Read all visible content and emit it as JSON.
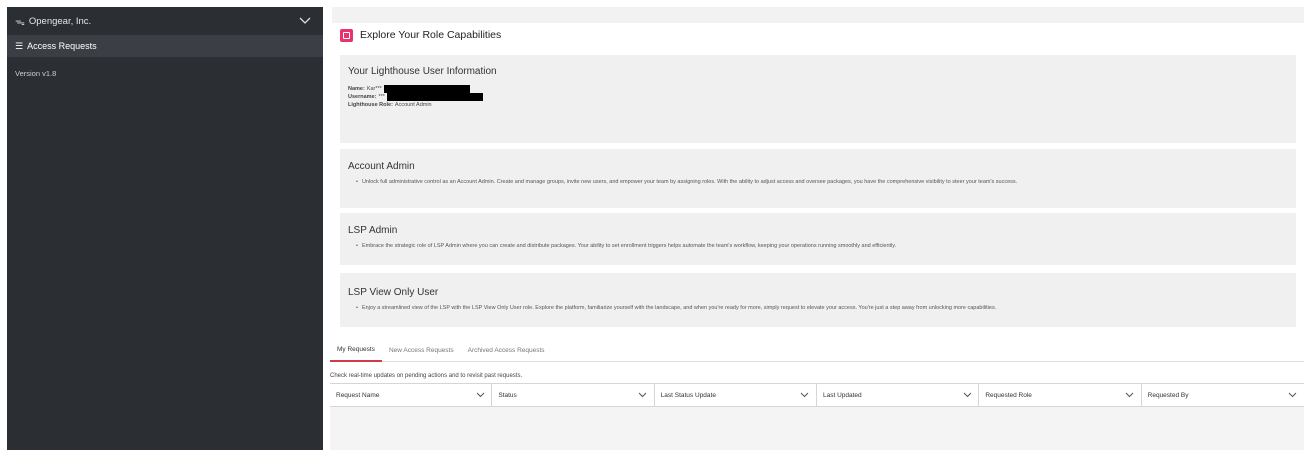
{
  "sidebar": {
    "org_name": "Opengear, Inc.",
    "nav_items": [
      {
        "label": "Access Requests",
        "icon": "list-icon"
      }
    ],
    "version": "Version v1.8"
  },
  "page": {
    "title": "Explore Your Role Capabilities",
    "accent_color": "#e8336d"
  },
  "user_info": {
    "title": "Your Lighthouse User Information",
    "name_label": "Name:",
    "name_value": "Kar***",
    "username_label": "Username:",
    "username_value": "***",
    "role_label": "Lighthouse Role:",
    "role_value": "Account Admin"
  },
  "roles": [
    {
      "title": "Account Admin",
      "description": "Unlock full administrative control as an Account Admin. Create and manage groups, invite new users, and empower your team by assigning roles. With the ability to adjust access and oversee packages, you have the comprehensive visibility to steer your team's success."
    },
    {
      "title": "LSP Admin",
      "description": "Embrace the strategic role of LSP Admin where you can create and distribute packages. Your ability to set enrollment triggers helps automate the team's workflow, keeping your operations running smoothly and efficiently."
    },
    {
      "title": "LSP View Only User",
      "description": "Enjoy a streamlined view of the LSP with the LSP View Only User role. Explore the platform, familiarize yourself with the landscape, and when you're ready for more, simply request to elevate your access. You're just a step away from unlocking more capabilities."
    }
  ],
  "tabs": [
    {
      "label": "My Requests",
      "active": true
    },
    {
      "label": "New Access Requests",
      "active": false
    },
    {
      "label": "Archived Access Requests",
      "active": false
    }
  ],
  "helper_text": "Check real-time updates on pending actions and to revisit past requests.",
  "table": {
    "columns": [
      "Request Name",
      "Status",
      "Last Status Update",
      "Last Updated",
      "Requested Role",
      "Requested By"
    ]
  }
}
